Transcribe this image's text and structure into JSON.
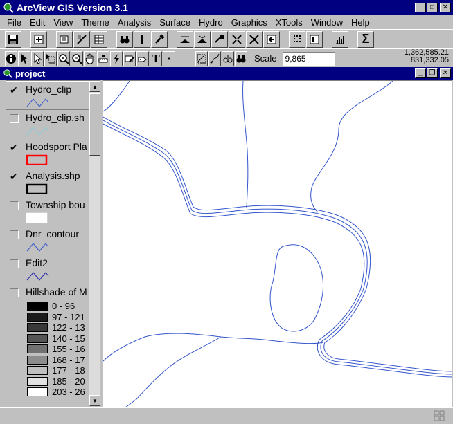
{
  "app": {
    "title": "ArcView GIS Version 3.1"
  },
  "menu": [
    "File",
    "Edit",
    "View",
    "Theme",
    "Analysis",
    "Surface",
    "Hydro",
    "Graphics",
    "XTools",
    "Window",
    "Help"
  ],
  "toolbar2": {
    "scale_label": "Scale",
    "scale_value": "9,865",
    "coord_x": "1,362,585.21",
    "coord_y": "831,332.05",
    "text_tool": "T"
  },
  "view": {
    "title": "project"
  },
  "layers": [
    {
      "name": "Hydro_clip",
      "checked": true,
      "symbol": "line",
      "color": "#3355cc"
    },
    {
      "name": "Hydro_clip.sh",
      "checked": false,
      "symbol": "line",
      "color": "#88ccdd"
    },
    {
      "name": "Hoodsport Pla",
      "checked": true,
      "symbol": "rect",
      "color": "#ff0000"
    },
    {
      "name": "Analysis.shp",
      "checked": true,
      "symbol": "rect",
      "color": "#000000"
    },
    {
      "name": "Township bou",
      "checked": false,
      "symbol": "rect",
      "color": "#ffffff"
    },
    {
      "name": "Dnr_contour",
      "checked": false,
      "symbol": "line",
      "color": "#3355cc"
    },
    {
      "name": "Edit2",
      "checked": false,
      "symbol": "line",
      "color": "#2222aa"
    },
    {
      "name": "Hillshade of M",
      "checked": false,
      "symbol": "none",
      "color": ""
    }
  ],
  "hillshade_legend": [
    {
      "label": "0 - 96",
      "color": "#000000"
    },
    {
      "label": "97 - 121",
      "color": "#1c1c1c"
    },
    {
      "label": "122 - 13",
      "color": "#383838"
    },
    {
      "label": "140 - 15",
      "color": "#555555"
    },
    {
      "label": "155 - 16",
      "color": "#717171"
    },
    {
      "label": "168 - 17",
      "color": "#8d8d8d"
    },
    {
      "label": "177 - 18",
      "color": "#c0c0c0"
    },
    {
      "label": "185 - 20",
      "color": "#e2e2e2"
    },
    {
      "label": "203 - 26",
      "color": "#ffffff"
    }
  ],
  "colors": {
    "titlebar": "#000080",
    "map_lines": "#3355cc"
  }
}
